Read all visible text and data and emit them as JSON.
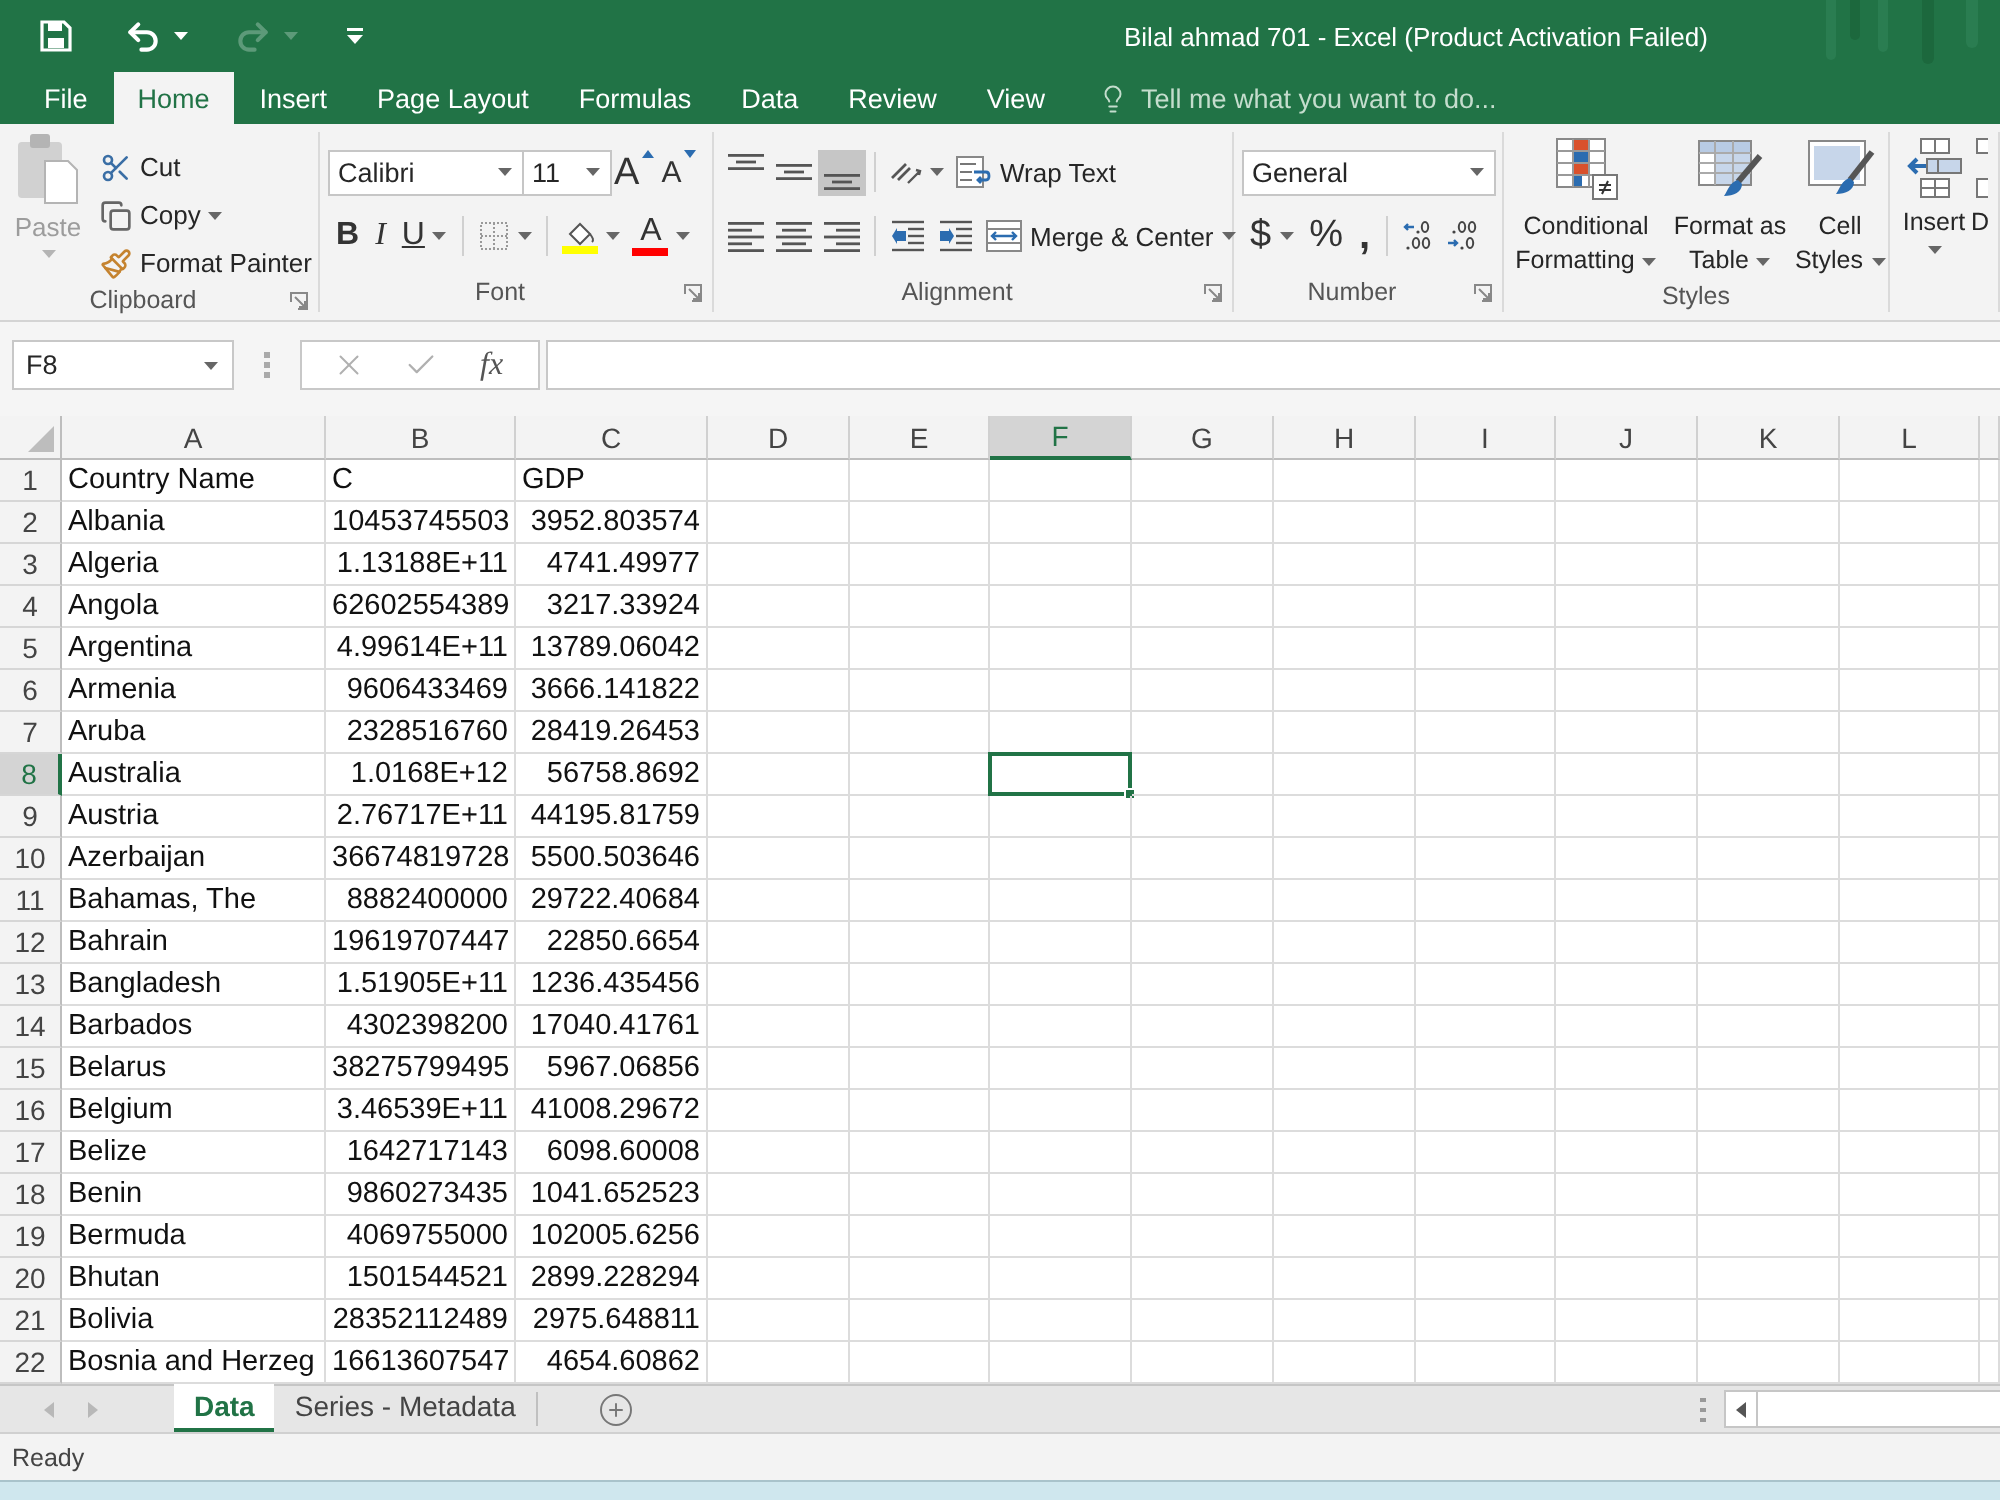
{
  "quick_access": [
    {
      "kind": "save",
      "disabled": false
    },
    {
      "kind": "undo",
      "disabled": false
    },
    {
      "kind": "redo",
      "disabled": true
    },
    {
      "kind": "customize",
      "disabled": false
    }
  ],
  "title_bar": {
    "title": "Bilal ahmad 701 - Excel (Product Activation Failed)"
  },
  "tabs": [
    {
      "label": "File",
      "selected": false
    },
    {
      "label": "Home",
      "selected": true
    },
    {
      "label": "Insert",
      "selected": false
    },
    {
      "label": "Page Layout",
      "selected": false
    },
    {
      "label": "Formulas",
      "selected": false
    },
    {
      "label": "Data",
      "selected": false
    },
    {
      "label": "Review",
      "selected": false
    },
    {
      "label": "View",
      "selected": false
    }
  ],
  "tell_me": {
    "placeholder": "Tell me what you want to do..."
  },
  "ribbon": {
    "clipboard": {
      "label": "Clipboard",
      "paste": {
        "label": "Paste",
        "disabled": true
      },
      "cut": "Cut",
      "copy": "Copy",
      "format_painter": "Format Painter"
    },
    "font": {
      "label": "Font",
      "font_name": "Calibri",
      "font_size": "11",
      "grow": "A",
      "shrink": "A",
      "bold": "B",
      "italic": "I",
      "underline": "U",
      "font_color": "A"
    },
    "alignment": {
      "label": "Alignment",
      "vertical": [
        {
          "kind": "top",
          "selected": false
        },
        {
          "kind": "middle",
          "selected": false
        },
        {
          "kind": "bottom",
          "selected": true
        }
      ],
      "wrap_text": "Wrap Text",
      "merge_center": "Merge & Center"
    },
    "number": {
      "label": "Number",
      "format": "General",
      "currency": "$",
      "percent": "%",
      "comma": ","
    },
    "styles": {
      "label": "Styles",
      "buttons": [
        {
          "kind": "conditional",
          "lines": [
            "Conditional",
            "Formatting"
          ]
        },
        {
          "kind": "table",
          "lines": [
            "Format as",
            "Table"
          ]
        },
        {
          "kind": "cell",
          "lines": [
            "Cell",
            "Styles"
          ]
        }
      ]
    },
    "cells": {
      "buttons": [
        {
          "kind": "insert",
          "label": "Insert"
        },
        {
          "kind": "delete",
          "label": "D"
        }
      ]
    }
  },
  "formula_bar": {
    "name_box": "F8",
    "function_label": "fx"
  },
  "grid": {
    "columns": [
      {
        "label": "A",
        "selected": false
      },
      {
        "label": "B",
        "selected": false
      },
      {
        "label": "C",
        "selected": false
      },
      {
        "label": "D",
        "selected": false
      },
      {
        "label": "E",
        "selected": false
      },
      {
        "label": "F",
        "selected": true
      },
      {
        "label": "G",
        "selected": false
      },
      {
        "label": "H",
        "selected": false
      },
      {
        "label": "I",
        "selected": false
      },
      {
        "label": "J",
        "selected": false
      },
      {
        "label": "K",
        "selected": false
      },
      {
        "label": "L",
        "selected": false
      }
    ],
    "rows": [
      {
        "number": "1",
        "selected": false,
        "kind": "heading",
        "cells": [
          "Country Name",
          "C",
          "GDP"
        ]
      },
      {
        "number": "2",
        "selected": false,
        "kind": "record",
        "cells": [
          "Albania",
          "10453745503",
          "3952.803574"
        ]
      },
      {
        "number": "3",
        "selected": false,
        "kind": "record",
        "cells": [
          "Algeria",
          "1.13188E+11",
          "4741.49977"
        ]
      },
      {
        "number": "4",
        "selected": false,
        "kind": "record",
        "cells": [
          "Angola",
          "62602554389",
          "3217.33924"
        ]
      },
      {
        "number": "5",
        "selected": false,
        "kind": "record",
        "cells": [
          "Argentina",
          "4.99614E+11",
          "13789.06042"
        ]
      },
      {
        "number": "6",
        "selected": false,
        "kind": "record",
        "cells": [
          "Armenia",
          "9606433469",
          "3666.141822"
        ]
      },
      {
        "number": "7",
        "selected": false,
        "kind": "record",
        "cells": [
          "Aruba",
          "2328516760",
          "28419.26453"
        ]
      },
      {
        "number": "8",
        "selected": true,
        "kind": "record",
        "cells": [
          "Australia",
          "1.0168E+12",
          "56758.8692"
        ]
      },
      {
        "number": "9",
        "selected": false,
        "kind": "record",
        "cells": [
          "Austria",
          "2.76717E+11",
          "44195.81759"
        ]
      },
      {
        "number": "10",
        "selected": false,
        "kind": "record",
        "cells": [
          "Azerbaijan",
          "36674819728",
          "5500.503646"
        ]
      },
      {
        "number": "11",
        "selected": false,
        "kind": "record",
        "cells": [
          "Bahamas, The",
          "8882400000",
          "29722.40684"
        ]
      },
      {
        "number": "12",
        "selected": false,
        "kind": "record",
        "cells": [
          "Bahrain",
          "19619707447",
          "22850.6654"
        ]
      },
      {
        "number": "13",
        "selected": false,
        "kind": "record",
        "cells": [
          "Bangladesh",
          "1.51905E+11",
          "1236.435456"
        ]
      },
      {
        "number": "14",
        "selected": false,
        "kind": "record",
        "cells": [
          "Barbados",
          "4302398200",
          "17040.41761"
        ]
      },
      {
        "number": "15",
        "selected": false,
        "kind": "record",
        "cells": [
          "Belarus",
          "38275799495",
          "5967.06856"
        ]
      },
      {
        "number": "16",
        "selected": false,
        "kind": "record",
        "cells": [
          "Belgium",
          "3.46539E+11",
          "41008.29672"
        ]
      },
      {
        "number": "17",
        "selected": false,
        "kind": "record",
        "cells": [
          "Belize",
          "1642717143",
          "6098.60008"
        ]
      },
      {
        "number": "18",
        "selected": false,
        "kind": "record",
        "cells": [
          "Benin",
          "9860273435",
          "1041.652523"
        ]
      },
      {
        "number": "19",
        "selected": false,
        "kind": "record",
        "cells": [
          "Bermuda",
          "4069755000",
          "102005.6256"
        ]
      },
      {
        "number": "20",
        "selected": false,
        "kind": "record",
        "cells": [
          "Bhutan",
          "1501544521",
          "2899.228294"
        ]
      },
      {
        "number": "21",
        "selected": false,
        "kind": "record",
        "cells": [
          "Bolivia",
          "28352112489",
          "2975.648811"
        ]
      },
      {
        "number": "22",
        "selected": false,
        "kind": "record",
        "cells": [
          "Bosnia and Herzeg",
          "16613607547",
          "4654.60862"
        ]
      }
    ]
  },
  "sheet_tabs": [
    {
      "label": "Data",
      "selected": true
    },
    {
      "label": "Series - Metadata",
      "selected": false
    }
  ],
  "status_bar": {
    "status": "Ready"
  }
}
